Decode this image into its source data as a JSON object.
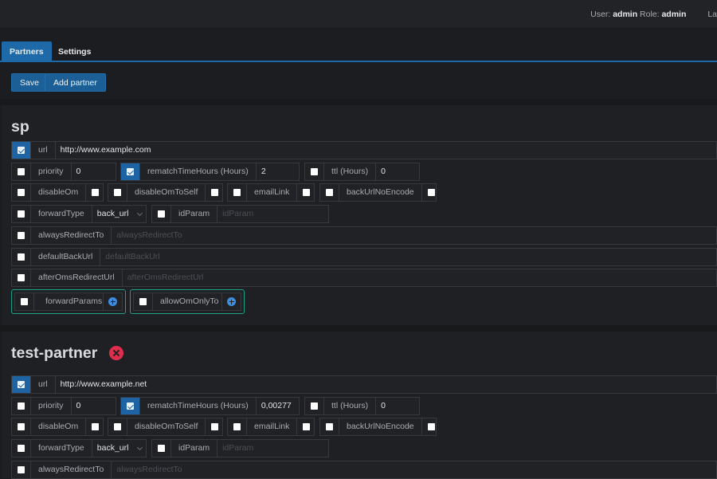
{
  "header": {
    "user_label": "User:",
    "user_value": "admin",
    "role_label": "Role:",
    "role_value": "admin",
    "extra_cut": "La"
  },
  "tabs": [
    {
      "label": "Partners",
      "active": true
    },
    {
      "label": "Settings",
      "active": false
    }
  ],
  "toolbar": {
    "save_label": "Save",
    "add_partner_label": "Add partner"
  },
  "partners": [
    {
      "name": "sp",
      "url": {
        "label": "url",
        "checked": true,
        "value": "http://www.example.com"
      },
      "priority": {
        "label": "priority",
        "checked": false,
        "value": "0"
      },
      "rematchTimeHours": {
        "label": "rematchTimeHours (Hours)",
        "checked": true,
        "value": "2"
      },
      "ttl": {
        "label": "ttl (Hours)",
        "checked": false,
        "value": "0"
      },
      "disableOm": {
        "label": "disableOm",
        "checked": false,
        "value_checked": false
      },
      "disableOmToSelf": {
        "label": "disableOmToSelf",
        "checked": false,
        "value_checked": false
      },
      "emailLink": {
        "label": "emailLink",
        "checked": false,
        "value_checked": false
      },
      "backUrlNoEncode": {
        "label": "backUrlNoEncode",
        "checked": false,
        "value_checked": false
      },
      "forwardType": {
        "label": "forwardType",
        "checked": false,
        "value": "back_url"
      },
      "idParam": {
        "label": "idParam",
        "checked": false,
        "placeholder": "idParam"
      },
      "alwaysRedirectTo": {
        "label": "alwaysRedirectTo",
        "checked": false,
        "placeholder": "alwaysRedirectTo"
      },
      "defaultBackUrl": {
        "label": "defaultBackUrl",
        "checked": false,
        "placeholder": "defaultBackUrl"
      },
      "afterOmsRedirectUrl": {
        "label": "afterOmsRedirectUrl",
        "checked": false,
        "placeholder": "afterOmsRedirectUrl"
      },
      "forwardParams": {
        "label": "forwardParams",
        "checked": false
      },
      "allowOmOnlyTo": {
        "label": "allowOmOnlyTo",
        "checked": false
      }
    },
    {
      "name": "test-partner",
      "url": {
        "label": "url",
        "checked": true,
        "value": "http://www.example.net"
      },
      "priority": {
        "label": "priority",
        "checked": false,
        "value": "0"
      },
      "rematchTimeHours": {
        "label": "rematchTimeHours (Hours)",
        "checked": true,
        "value": "0,00277"
      },
      "ttl": {
        "label": "ttl (Hours)",
        "checked": false,
        "value": "0"
      },
      "disableOm": {
        "label": "disableOm",
        "checked": false,
        "value_checked": false
      },
      "disableOmToSelf": {
        "label": "disableOmToSelf",
        "checked": false,
        "value_checked": false
      },
      "emailLink": {
        "label": "emailLink",
        "checked": false,
        "value_checked": false
      },
      "backUrlNoEncode": {
        "label": "backUrlNoEncode",
        "checked": false,
        "value_checked": false
      },
      "forwardType": {
        "label": "forwardType",
        "checked": false,
        "value": "back_url"
      },
      "idParam": {
        "label": "idParam",
        "checked": false,
        "placeholder": "idParam"
      },
      "alwaysRedirectTo": {
        "label": "alwaysRedirectTo",
        "checked": false,
        "placeholder": "alwaysRedirectTo"
      }
    }
  ],
  "colors": {
    "accent": "#1e6aa8",
    "teal_border": "#1fa08a",
    "delete_red": "#e02d4c",
    "add_blue": "#3d8ee0"
  }
}
